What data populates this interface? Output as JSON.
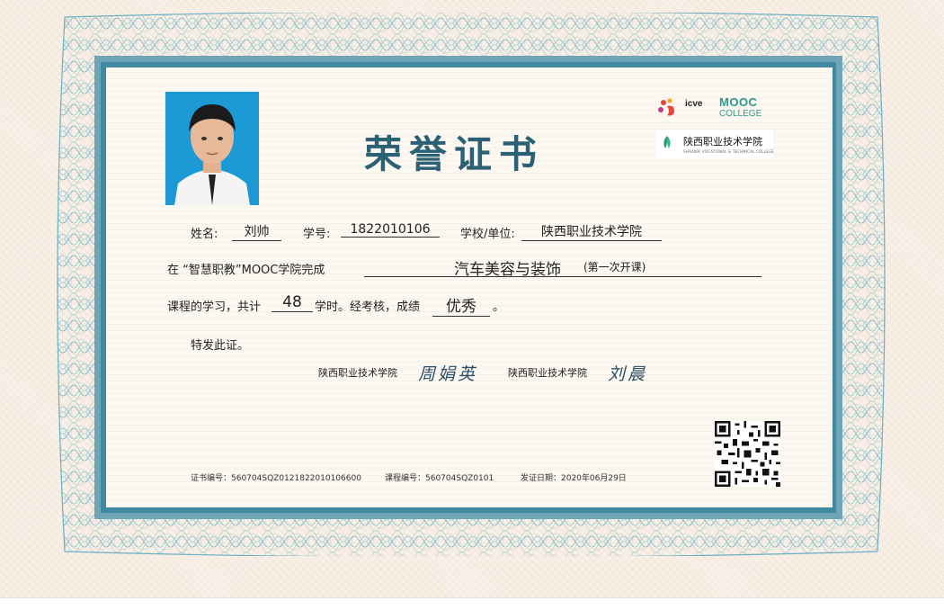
{
  "certificate": {
    "title": "荣誉证书",
    "logos": {
      "icve_text": "icve",
      "mooc_text": "MOOC",
      "college_text": "COLLEGE",
      "school_logo_text": "陕西职业技术学院",
      "school_logo_sub": "SHAANXI VOCATIONAL & TECHNICAL COLLEGE"
    },
    "fields": {
      "name_label": "姓名:",
      "name_value": "刘帅",
      "id_label": "学号:",
      "id_value": "1822010106",
      "school_label": "学校/单位:",
      "school_value": "陕西职业技术学院"
    },
    "body": {
      "line2_prefix": "在 “智慧职教”MOOC学院完成",
      "course_name": "汽车美容与装饰",
      "course_note": "(第一次开课)",
      "line3_prefix": "课程的学习，共计",
      "hours": "48",
      "line3_mid": "学时。经考核，成绩",
      "grade": "优秀",
      "line3_end": "。",
      "closing": "特发此证。"
    },
    "signatures": [
      {
        "school": "陕西职业技术学院",
        "name": "周娟英"
      },
      {
        "school": "陕西职业技术学院",
        "name": "刘晨"
      }
    ],
    "footer": {
      "cert_no": "证书编号：560704SQZ0121822010106600",
      "course_no": "课程编号：560704SQZ0101",
      "issue_date": "发证日期：2020年06月29日"
    },
    "colors": {
      "frame": "#3f8aa0",
      "title": "#2c6175",
      "photo_bg": "#1d9ad6"
    }
  }
}
